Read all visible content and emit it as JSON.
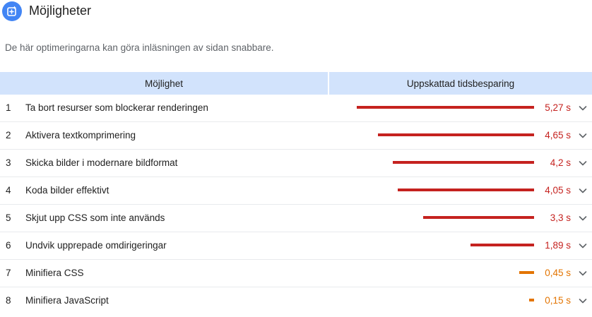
{
  "header": {
    "title": "Möjligheter",
    "icon": "speed-opportunity-icon",
    "icon_color": "#4285f4"
  },
  "description": "De här optimeringarna kan göra inläsningen av sidan snabbare.",
  "table": {
    "columns": [
      "Möjlighet",
      "Uppskattad tidsbesparing"
    ],
    "header_color": "#d2e3fc",
    "max_savings_s": 5.27,
    "rows": [
      {
        "index": "1",
        "title": "Ta bort resurser som blockerar renderingen",
        "value_text": "5,27 s",
        "savings_s": 5.27,
        "severity": "fail"
      },
      {
        "index": "2",
        "title": "Aktivera textkomprimering",
        "value_text": "4,65 s",
        "savings_s": 4.65,
        "severity": "fail"
      },
      {
        "index": "3",
        "title": "Skicka bilder i modernare bildformat",
        "value_text": "4,2 s",
        "savings_s": 4.2,
        "severity": "fail"
      },
      {
        "index": "4",
        "title": "Koda bilder effektivt",
        "value_text": "4,05 s",
        "savings_s": 4.05,
        "severity": "fail"
      },
      {
        "index": "5",
        "title": "Skjut upp CSS som inte används",
        "value_text": "3,3 s",
        "savings_s": 3.3,
        "severity": "fail"
      },
      {
        "index": "6",
        "title": "Undvik upprepade omdirigeringar",
        "value_text": "1,89 s",
        "savings_s": 1.89,
        "severity": "fail"
      },
      {
        "index": "7",
        "title": "Minifiera CSS",
        "value_text": "0,45 s",
        "savings_s": 0.45,
        "severity": "average"
      },
      {
        "index": "8",
        "title": "Minifiera JavaScript",
        "value_text": "0,15 s",
        "savings_s": 0.15,
        "severity": "average"
      }
    ]
  },
  "colors": {
    "fail": "#c5221f",
    "average": "#e37400",
    "chevron": "#5f6368"
  }
}
